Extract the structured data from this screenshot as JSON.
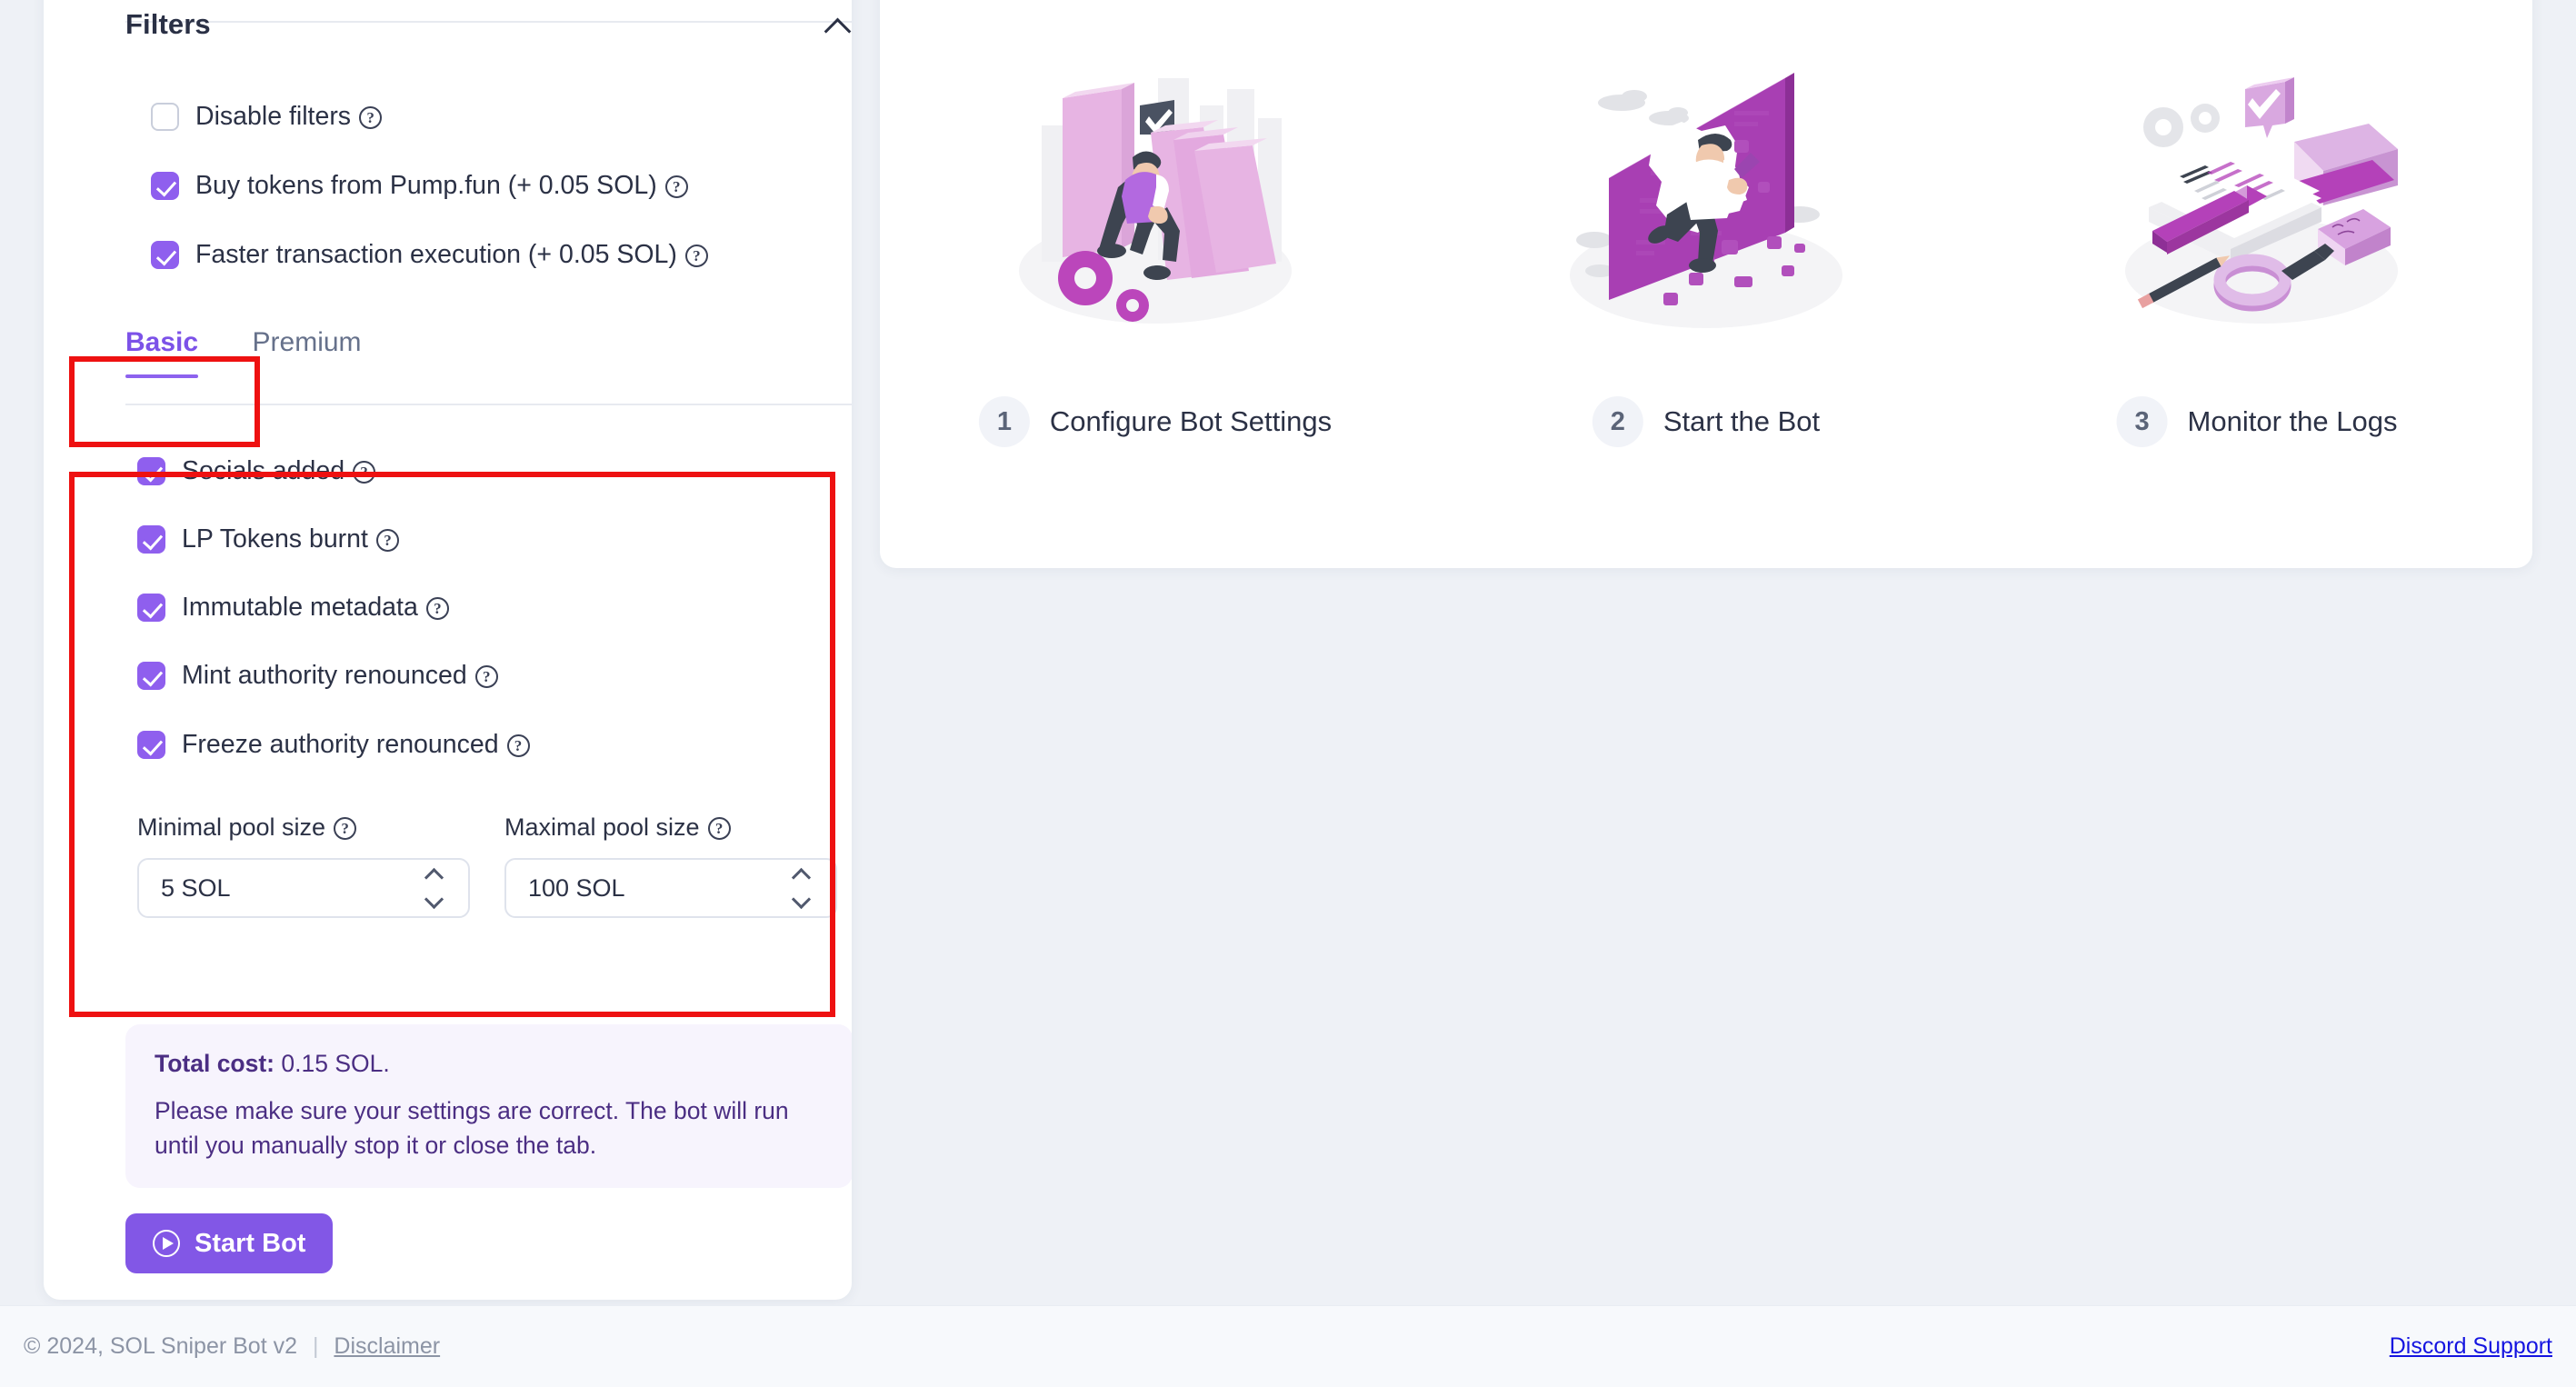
{
  "colors": {
    "accent_purple": "#8257e6",
    "checkbox_purple": "#8f5fee",
    "annotation_red": "#ee1111",
    "link_blue": "#1414e0",
    "page_bg": "#eef1f6"
  },
  "filters_panel": {
    "title": "Filters",
    "collapse_icon": "chevron-up-icon",
    "top_checkboxes": [
      {
        "label": "Disable filters",
        "checked": false,
        "help": "help-icon"
      },
      {
        "label": "Buy tokens from Pump.fun (+ 0.05 SOL)",
        "checked": true,
        "help": "help-icon"
      },
      {
        "label": "Faster transaction execution (+ 0.05 SOL)",
        "checked": true,
        "help": "help-icon"
      }
    ],
    "tabs": [
      {
        "label": "Basic",
        "active": true
      },
      {
        "label": "Premium",
        "active": false
      }
    ],
    "basic_checkboxes": [
      {
        "label": "Socials added",
        "checked": true,
        "help": "help-icon"
      },
      {
        "label": "LP Tokens burnt",
        "checked": true,
        "help": "help-icon"
      },
      {
        "label": "Immutable metadata",
        "checked": true,
        "help": "help-icon"
      },
      {
        "label": "Mint authority renounced",
        "checked": true,
        "help": "help-icon"
      },
      {
        "label": "Freeze authority renounced",
        "checked": true,
        "help": "help-icon"
      }
    ],
    "pool_sizes": [
      {
        "label": "Minimal pool size",
        "value": "5 SOL",
        "help": "help-icon"
      },
      {
        "label": "Maximal pool size",
        "value": "100 SOL",
        "help": "help-icon"
      }
    ],
    "cost": {
      "label": "Total cost:",
      "value": "0.15 SOL.",
      "note": "Please make sure your settings are correct. The bot will run until you manually stop it or close the tab."
    },
    "start_button": {
      "label": "Start Bot",
      "icon": "play-circle-icon"
    }
  },
  "steps_panel": {
    "steps": [
      {
        "number": "1",
        "label": "Configure Bot Settings",
        "illustration": "person-pushing-dominoes-with-gears"
      },
      {
        "number": "2",
        "label": "Start the Bot",
        "illustration": "person-breaking-through-wall"
      },
      {
        "number": "3",
        "label": "Monitor the Logs",
        "illustration": "research-documents-book-magnifier"
      }
    ]
  },
  "footer": {
    "copyright": "© 2024, SOL Sniper Bot v2",
    "separator": "|",
    "disclaimer_label": "Disclaimer",
    "support_label": "Discord Support"
  }
}
